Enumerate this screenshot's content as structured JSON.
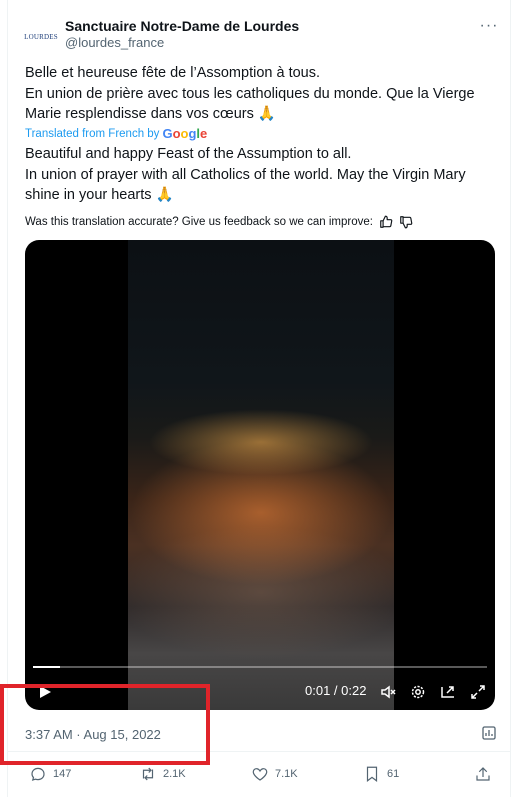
{
  "account": {
    "avatar_text": "LOURDES",
    "name": "Sanctuaire Notre-Dame de Lourdes",
    "handle": "@lourdes_france"
  },
  "tweet": {
    "original_text": "Belle et heureuse fête de l’Assomption à tous.\nEn union de prière avec tous les catholiques du monde. Que la Vierge Marie resplendisse dans vos cœurs 🙏",
    "translated_label": "Translated from French by",
    "google_brand": "Google",
    "translated_text": "Beautiful and happy Feast of the Assumption to all.\nIn union of prayer with all Catholics of the world. May the Virgin Mary shine in your hearts 🙏",
    "feedback_prompt": "Was this translation accurate? Give us feedback so we can improve:"
  },
  "video": {
    "time": "0:01 / 0:22",
    "progress_fraction": 0.06
  },
  "timestamp": "3:37 AM · Aug 15, 2022",
  "actions": {
    "replies": "147",
    "reposts": "2.1K",
    "likes": "7.1K",
    "bookmarks": "61"
  },
  "colors": {
    "accent": "#1d9bf0",
    "highlight_box": "#e0242a",
    "muted_text": "#536471"
  }
}
